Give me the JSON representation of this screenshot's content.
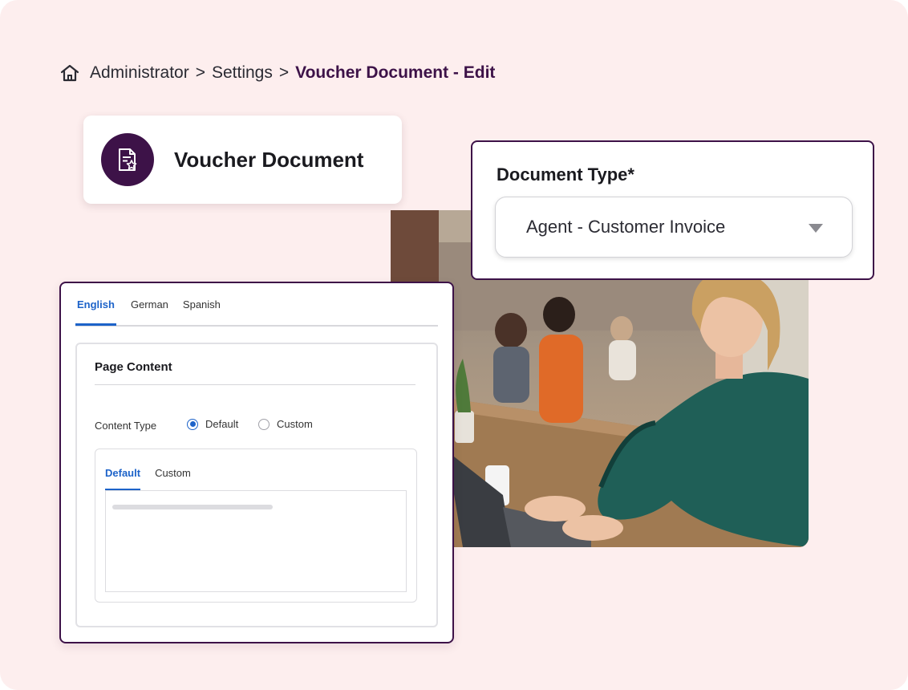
{
  "breadcrumb": {
    "items": [
      "Administrator",
      "Settings"
    ],
    "separator": ">",
    "current": "Voucher Document - Edit"
  },
  "voucher_card": {
    "title": "Voucher Document",
    "icon": "document-star-icon",
    "avatar_color": "#3d1248"
  },
  "document_type": {
    "label": "Document Type*",
    "selected": "Agent - Customer Invoice"
  },
  "language_tabs": [
    {
      "label": "English",
      "active": true
    },
    {
      "label": "German",
      "active": false
    },
    {
      "label": "Spanish",
      "active": false
    }
  ],
  "page_content": {
    "title": "Page Content",
    "content_type_label": "Content Type",
    "options": [
      {
        "label": "Default",
        "selected": true
      },
      {
        "label": "Custom",
        "selected": false
      }
    ],
    "editor_tabs": [
      {
        "label": "Default",
        "active": true
      },
      {
        "label": "Custom",
        "active": false
      }
    ]
  },
  "colors": {
    "accent": "#3d1248",
    "link_blue": "#1d63c9",
    "background": "#fdeeee"
  }
}
